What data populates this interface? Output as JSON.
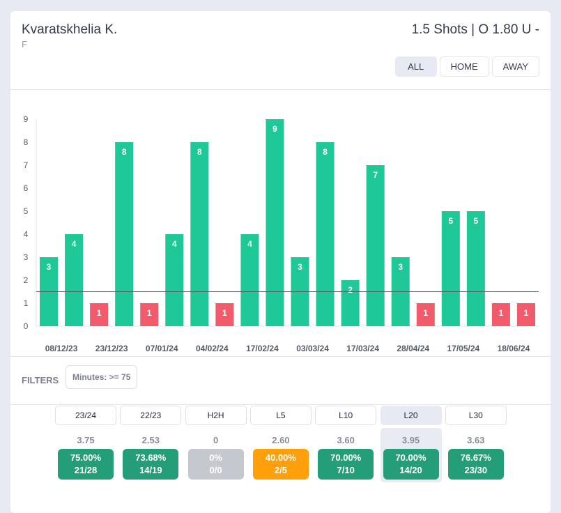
{
  "header": {
    "player_name": "Kvaratskhelia K.",
    "position": "F",
    "market": "1.5 Shots | O 1.80 U -"
  },
  "venue_filter": {
    "options": [
      "ALL",
      "HOME",
      "AWAY"
    ],
    "selected": "ALL"
  },
  "chart_data": {
    "type": "bar",
    "title": "",
    "xlabel": "",
    "ylabel": "",
    "ylim": [
      0,
      9
    ],
    "yticks": [
      0,
      1,
      2,
      3,
      4,
      5,
      6,
      7,
      8,
      9
    ],
    "threshold": 1.5,
    "x_tick_labels": [
      "08/12/23",
      "23/12/23",
      "07/01/24",
      "04/02/24",
      "17/02/24",
      "03/03/24",
      "17/03/24",
      "28/04/24",
      "17/05/24",
      "18/06/24"
    ],
    "label_every": 2,
    "values": [
      3,
      4,
      1,
      8,
      1,
      4,
      8,
      1,
      4,
      9,
      3,
      8,
      2,
      7,
      3,
      1,
      5,
      5,
      1,
      1
    ],
    "colors": {
      "over": "#1ec997",
      "under": "#f15b6c",
      "threshold_line": "#555a63"
    },
    "grid": false,
    "legend": "none"
  },
  "filters": {
    "label": "FILTERS",
    "chips": [
      "Minutes: >= 75"
    ]
  },
  "periods": [
    {
      "label": "23/24",
      "avg": "3.75",
      "pct": "75.00%",
      "ratio": "21/28",
      "status": "good"
    },
    {
      "label": "22/23",
      "avg": "2.53",
      "pct": "73.68%",
      "ratio": "14/19",
      "status": "good"
    },
    {
      "label": "H2H",
      "avg": "0",
      "pct": "0%",
      "ratio": "0/0",
      "status": "none"
    },
    {
      "label": "L5",
      "avg": "2.60",
      "pct": "40.00%",
      "ratio": "2/5",
      "status": "mid"
    },
    {
      "label": "L10",
      "avg": "3.60",
      "pct": "70.00%",
      "ratio": "7/10",
      "status": "good"
    },
    {
      "label": "L20",
      "avg": "3.95",
      "pct": "70.00%",
      "ratio": "14/20",
      "status": "good",
      "selected": true
    },
    {
      "label": "L30",
      "avg": "3.63",
      "pct": "76.67%",
      "ratio": "23/30",
      "status": "good"
    }
  ],
  "status_colors": {
    "good": "#249e78",
    "mid": "#ff9f0a",
    "none": "#c6c8d0"
  }
}
